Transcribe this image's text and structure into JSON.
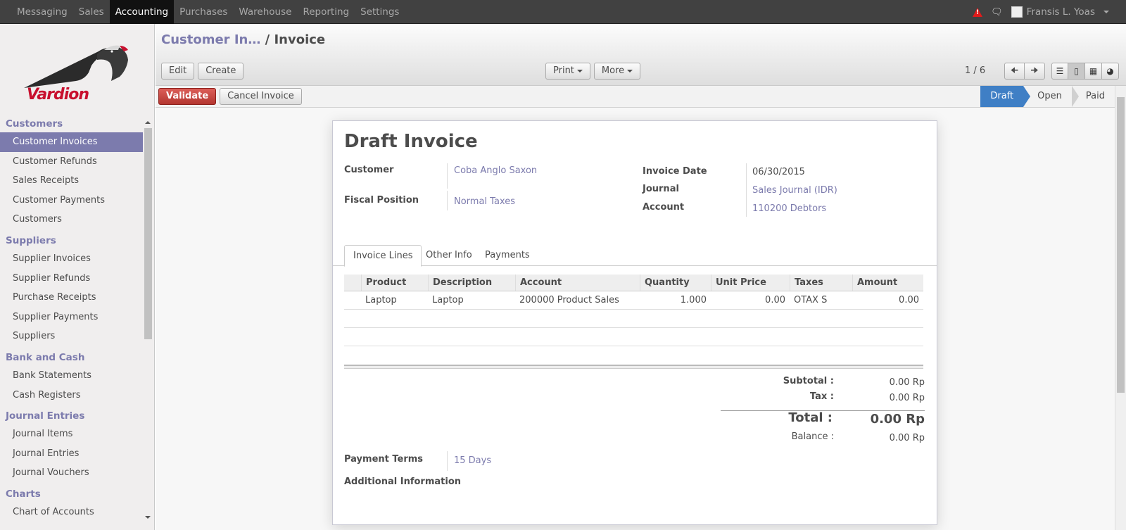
{
  "topbar": {
    "menu": [
      "Messaging",
      "Sales",
      "Accounting",
      "Purchases",
      "Warehouse",
      "Reporting",
      "Settings"
    ],
    "active": "Accounting",
    "user_name": "Fransis L. Yoas"
  },
  "sidebar": {
    "logo_text": "Vardion",
    "sections": [
      {
        "title": "Customers",
        "items": [
          "Customer Invoices",
          "Customer Refunds",
          "Sales Receipts",
          "Customer Payments",
          "Customers"
        ]
      },
      {
        "title": "Suppliers",
        "items": [
          "Supplier Invoices",
          "Supplier Refunds",
          "Purchase Receipts",
          "Supplier Payments",
          "Suppliers"
        ]
      },
      {
        "title": "Bank and Cash",
        "items": [
          "Bank Statements",
          "Cash Registers"
        ]
      },
      {
        "title": "Journal Entries",
        "items": [
          "Journal Items",
          "Journal Entries",
          "Journal Vouchers"
        ]
      },
      {
        "title": "Charts",
        "items": [
          "Chart of Accounts"
        ]
      }
    ],
    "active_item": "Customer Invoices"
  },
  "header": {
    "breadcrumb_parent": "Customer In…",
    "breadcrumb_sep": "/",
    "breadcrumb_current": "Invoice",
    "edit_label": "Edit",
    "create_label": "Create",
    "print_label": "Print",
    "more_label": "More",
    "pager": "1 / 6"
  },
  "statusbar": {
    "validate_label": "Validate",
    "cancel_label": "Cancel Invoice",
    "states": [
      "Draft",
      "Open",
      "Paid"
    ],
    "active_state": "Draft"
  },
  "form": {
    "title": "Draft Invoice",
    "customer_label": "Customer",
    "customer_value": "Coba Anglo Saxon",
    "fiscal_label": "Fiscal Position",
    "fiscal_value": "Normal Taxes",
    "date_label": "Invoice Date",
    "date_value": "06/30/2015",
    "journal_label": "Journal",
    "journal_value": "Sales Journal (IDR)",
    "account_label": "Account",
    "account_value": "110200 Debtors",
    "tabs": [
      "Invoice Lines",
      "Other Info",
      "Payments"
    ],
    "columns": [
      "Product",
      "Description",
      "Account",
      "Quantity",
      "Unit Price",
      "Taxes",
      "Amount"
    ],
    "lines": [
      {
        "product": "Laptop",
        "description": "Laptop",
        "account": "200000 Product Sales",
        "quantity": "1.000",
        "unit_price": "0.00",
        "taxes": "OTAX S",
        "amount": "0.00"
      }
    ],
    "subtotal_label": "Subtotal :",
    "subtotal_value": "0.00 Rp",
    "tax_label": "Tax :",
    "tax_value": "0.00 Rp",
    "total_label": "Total :",
    "total_value": "0.00 Rp",
    "balance_label": "Balance :",
    "balance_value": "0.00 Rp",
    "payment_terms_label": "Payment Terms",
    "payment_terms_value": "15 Days",
    "additional_info_label": "Additional Information"
  }
}
